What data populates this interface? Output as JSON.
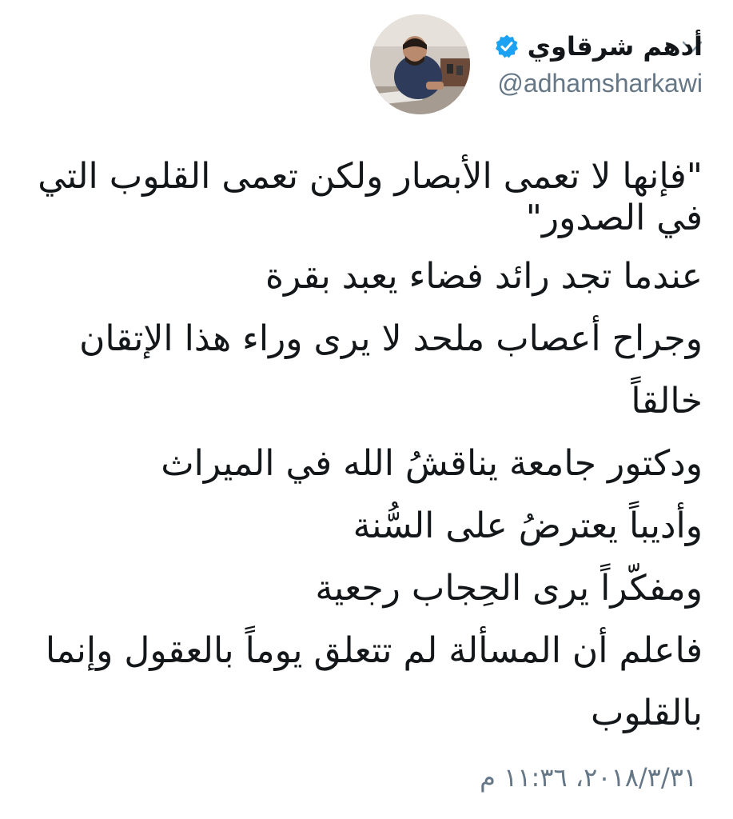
{
  "tweet": {
    "author": {
      "display_name": "أدهم شرقاوي",
      "handle": "@adhamsharkawi",
      "verified": true,
      "avatar_icon": "person-photo-avatar"
    },
    "menu_icon": "chevron-down-icon",
    "text_lines": [
      "\"فإنها لا تعمى الأبصار ولكن تعمى القلوب التي",
      "في الصدور\"",
      "عندما تجد رائد فضاء يعبد بقرة",
      "وجراح أعصاب ملحد لا يرى وراء هذا الإتقان",
      "خالقاً",
      "ودكتور جامعة يناقشُ الله في الميراث",
      "وأديباً يعترضُ على السُّنة",
      "ومفكّراً يرى الحِجاب رجعية",
      "فاعلم أن المسألة لم تتعلق يوماً بالعقول وإنما",
      "بالقلوب"
    ],
    "timestamp": "٢٠١٨/٣/٣١، ١١:٣٦ م"
  },
  "colors": {
    "text": "#14171a",
    "secondary": "#657786",
    "verified_badge": "#1da1f2",
    "chevron": "#8899a6"
  }
}
